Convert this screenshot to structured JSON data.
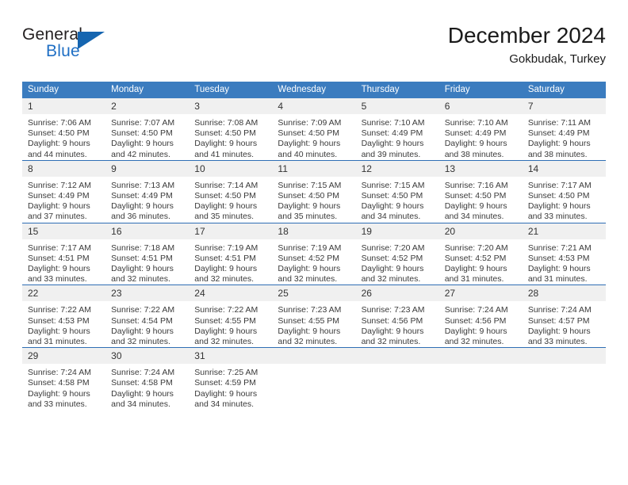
{
  "brand": {
    "name_part1": "General",
    "name_part2": "Blue",
    "logo_icon": "triangle-logo-icon"
  },
  "header": {
    "month_title": "December 2024",
    "location": "Gokbudak, Turkey"
  },
  "colors": {
    "header_bar": "#3b7cbf",
    "row_divider": "#2f6eb5",
    "daynum_background": "#f0f0f0",
    "brand_blue": "#1f6fc4",
    "logo_triangle": "#1565b0"
  },
  "calendar": {
    "weekday_headers": [
      "Sunday",
      "Monday",
      "Tuesday",
      "Wednesday",
      "Thursday",
      "Friday",
      "Saturday"
    ],
    "weeks": [
      [
        {
          "day": "1",
          "sunrise": "Sunrise: 7:06 AM",
          "sunset": "Sunset: 4:50 PM",
          "daylight_line1": "Daylight: 9 hours",
          "daylight_line2": "and 44 minutes."
        },
        {
          "day": "2",
          "sunrise": "Sunrise: 7:07 AM",
          "sunset": "Sunset: 4:50 PM",
          "daylight_line1": "Daylight: 9 hours",
          "daylight_line2": "and 42 minutes."
        },
        {
          "day": "3",
          "sunrise": "Sunrise: 7:08 AM",
          "sunset": "Sunset: 4:50 PM",
          "daylight_line1": "Daylight: 9 hours",
          "daylight_line2": "and 41 minutes."
        },
        {
          "day": "4",
          "sunrise": "Sunrise: 7:09 AM",
          "sunset": "Sunset: 4:50 PM",
          "daylight_line1": "Daylight: 9 hours",
          "daylight_line2": "and 40 minutes."
        },
        {
          "day": "5",
          "sunrise": "Sunrise: 7:10 AM",
          "sunset": "Sunset: 4:49 PM",
          "daylight_line1": "Daylight: 9 hours",
          "daylight_line2": "and 39 minutes."
        },
        {
          "day": "6",
          "sunrise": "Sunrise: 7:10 AM",
          "sunset": "Sunset: 4:49 PM",
          "daylight_line1": "Daylight: 9 hours",
          "daylight_line2": "and 38 minutes."
        },
        {
          "day": "7",
          "sunrise": "Sunrise: 7:11 AM",
          "sunset": "Sunset: 4:49 PM",
          "daylight_line1": "Daylight: 9 hours",
          "daylight_line2": "and 38 minutes."
        }
      ],
      [
        {
          "day": "8",
          "sunrise": "Sunrise: 7:12 AM",
          "sunset": "Sunset: 4:49 PM",
          "daylight_line1": "Daylight: 9 hours",
          "daylight_line2": "and 37 minutes."
        },
        {
          "day": "9",
          "sunrise": "Sunrise: 7:13 AM",
          "sunset": "Sunset: 4:49 PM",
          "daylight_line1": "Daylight: 9 hours",
          "daylight_line2": "and 36 minutes."
        },
        {
          "day": "10",
          "sunrise": "Sunrise: 7:14 AM",
          "sunset": "Sunset: 4:50 PM",
          "daylight_line1": "Daylight: 9 hours",
          "daylight_line2": "and 35 minutes."
        },
        {
          "day": "11",
          "sunrise": "Sunrise: 7:15 AM",
          "sunset": "Sunset: 4:50 PM",
          "daylight_line1": "Daylight: 9 hours",
          "daylight_line2": "and 35 minutes."
        },
        {
          "day": "12",
          "sunrise": "Sunrise: 7:15 AM",
          "sunset": "Sunset: 4:50 PM",
          "daylight_line1": "Daylight: 9 hours",
          "daylight_line2": "and 34 minutes."
        },
        {
          "day": "13",
          "sunrise": "Sunrise: 7:16 AM",
          "sunset": "Sunset: 4:50 PM",
          "daylight_line1": "Daylight: 9 hours",
          "daylight_line2": "and 34 minutes."
        },
        {
          "day": "14",
          "sunrise": "Sunrise: 7:17 AM",
          "sunset": "Sunset: 4:50 PM",
          "daylight_line1": "Daylight: 9 hours",
          "daylight_line2": "and 33 minutes."
        }
      ],
      [
        {
          "day": "15",
          "sunrise": "Sunrise: 7:17 AM",
          "sunset": "Sunset: 4:51 PM",
          "daylight_line1": "Daylight: 9 hours",
          "daylight_line2": "and 33 minutes."
        },
        {
          "day": "16",
          "sunrise": "Sunrise: 7:18 AM",
          "sunset": "Sunset: 4:51 PM",
          "daylight_line1": "Daylight: 9 hours",
          "daylight_line2": "and 32 minutes."
        },
        {
          "day": "17",
          "sunrise": "Sunrise: 7:19 AM",
          "sunset": "Sunset: 4:51 PM",
          "daylight_line1": "Daylight: 9 hours",
          "daylight_line2": "and 32 minutes."
        },
        {
          "day": "18",
          "sunrise": "Sunrise: 7:19 AM",
          "sunset": "Sunset: 4:52 PM",
          "daylight_line1": "Daylight: 9 hours",
          "daylight_line2": "and 32 minutes."
        },
        {
          "day": "19",
          "sunrise": "Sunrise: 7:20 AM",
          "sunset": "Sunset: 4:52 PM",
          "daylight_line1": "Daylight: 9 hours",
          "daylight_line2": "and 32 minutes."
        },
        {
          "day": "20",
          "sunrise": "Sunrise: 7:20 AM",
          "sunset": "Sunset: 4:52 PM",
          "daylight_line1": "Daylight: 9 hours",
          "daylight_line2": "and 31 minutes."
        },
        {
          "day": "21",
          "sunrise": "Sunrise: 7:21 AM",
          "sunset": "Sunset: 4:53 PM",
          "daylight_line1": "Daylight: 9 hours",
          "daylight_line2": "and 31 minutes."
        }
      ],
      [
        {
          "day": "22",
          "sunrise": "Sunrise: 7:22 AM",
          "sunset": "Sunset: 4:53 PM",
          "daylight_line1": "Daylight: 9 hours",
          "daylight_line2": "and 31 minutes."
        },
        {
          "day": "23",
          "sunrise": "Sunrise: 7:22 AM",
          "sunset": "Sunset: 4:54 PM",
          "daylight_line1": "Daylight: 9 hours",
          "daylight_line2": "and 32 minutes."
        },
        {
          "day": "24",
          "sunrise": "Sunrise: 7:22 AM",
          "sunset": "Sunset: 4:55 PM",
          "daylight_line1": "Daylight: 9 hours",
          "daylight_line2": "and 32 minutes."
        },
        {
          "day": "25",
          "sunrise": "Sunrise: 7:23 AM",
          "sunset": "Sunset: 4:55 PM",
          "daylight_line1": "Daylight: 9 hours",
          "daylight_line2": "and 32 minutes."
        },
        {
          "day": "26",
          "sunrise": "Sunrise: 7:23 AM",
          "sunset": "Sunset: 4:56 PM",
          "daylight_line1": "Daylight: 9 hours",
          "daylight_line2": "and 32 minutes."
        },
        {
          "day": "27",
          "sunrise": "Sunrise: 7:24 AM",
          "sunset": "Sunset: 4:56 PM",
          "daylight_line1": "Daylight: 9 hours",
          "daylight_line2": "and 32 minutes."
        },
        {
          "day": "28",
          "sunrise": "Sunrise: 7:24 AM",
          "sunset": "Sunset: 4:57 PM",
          "daylight_line1": "Daylight: 9 hours",
          "daylight_line2": "and 33 minutes."
        }
      ],
      [
        {
          "day": "29",
          "sunrise": "Sunrise: 7:24 AM",
          "sunset": "Sunset: 4:58 PM",
          "daylight_line1": "Daylight: 9 hours",
          "daylight_line2": "and 33 minutes."
        },
        {
          "day": "30",
          "sunrise": "Sunrise: 7:24 AM",
          "sunset": "Sunset: 4:58 PM",
          "daylight_line1": "Daylight: 9 hours",
          "daylight_line2": "and 34 minutes."
        },
        {
          "day": "31",
          "sunrise": "Sunrise: 7:25 AM",
          "sunset": "Sunset: 4:59 PM",
          "daylight_line1": "Daylight: 9 hours",
          "daylight_line2": "and 34 minutes."
        },
        {
          "day": "",
          "sunrise": "",
          "sunset": "",
          "daylight_line1": "",
          "daylight_line2": ""
        },
        {
          "day": "",
          "sunrise": "",
          "sunset": "",
          "daylight_line1": "",
          "daylight_line2": ""
        },
        {
          "day": "",
          "sunrise": "",
          "sunset": "",
          "daylight_line1": "",
          "daylight_line2": ""
        },
        {
          "day": "",
          "sunrise": "",
          "sunset": "",
          "daylight_line1": "",
          "daylight_line2": ""
        }
      ]
    ]
  }
}
